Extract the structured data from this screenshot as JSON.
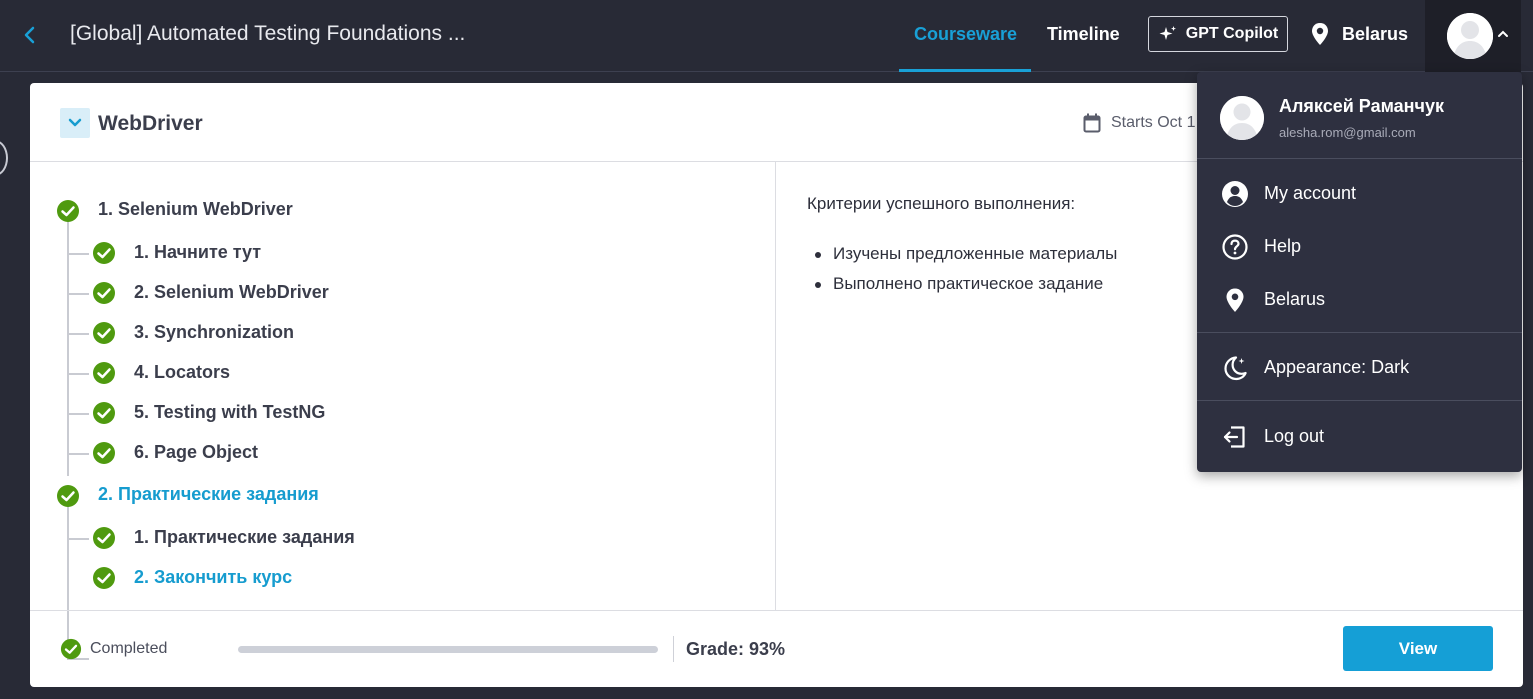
{
  "header": {
    "course_title": "[Global] Automated Testing Foundations ...",
    "tabs": [
      {
        "label": "Courseware",
        "active": true
      },
      {
        "label": "Timeline",
        "active": false
      }
    ],
    "copilot_label": "GPT Copilot",
    "location": "Belarus"
  },
  "section": {
    "title": "WebDriver",
    "starts": "Starts Oct 1"
  },
  "outline": {
    "units": [
      {
        "label": "1. Selenium WebDriver",
        "highlight": false,
        "items": [
          {
            "label": "1. Начните тут",
            "highlight": false
          },
          {
            "label": "2. Selenium WebDriver",
            "highlight": false
          },
          {
            "label": "3. Synchronization",
            "highlight": false
          },
          {
            "label": "4. Locators",
            "highlight": false
          },
          {
            "label": "5. Testing with TestNG",
            "highlight": false
          },
          {
            "label": "6. Page Object",
            "highlight": false
          }
        ]
      },
      {
        "label": "2. Практические задания",
        "highlight": true,
        "items": [
          {
            "label": "1. Практические задания",
            "highlight": false
          },
          {
            "label": "2. Закончить курс",
            "highlight": true
          }
        ]
      }
    ]
  },
  "content": {
    "criteria_title": "Критерии успешного выполнения:",
    "criteria": [
      "Изучены предложенные материалы",
      "Выполнено практическое задание"
    ]
  },
  "footer": {
    "status": "Completed",
    "progress": 1.0,
    "grade": "Grade: 93%",
    "view_label": "View"
  },
  "user_menu": {
    "name": "Аляксей Раманчук",
    "email": "alesha.rom@gmail.com",
    "items": {
      "account": "My account",
      "help": "Help",
      "location": "Belarus",
      "appearance": "Appearance: Dark",
      "logout": "Log out"
    }
  },
  "colors": {
    "accent": "#169ccf",
    "check_green": "#4f9a0f",
    "header_bg": "#282a36",
    "menu_bg": "#2e3040"
  }
}
